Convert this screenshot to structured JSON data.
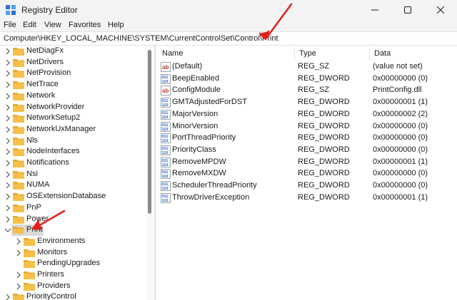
{
  "window": {
    "title": "Registry Editor"
  },
  "menu": {
    "file": "File",
    "edit": "Edit",
    "view": "View",
    "favorites": "Favorites",
    "help": "Help"
  },
  "address": "Computer\\HKEY_LOCAL_MACHINE\\SYSTEM\\CurrentControlSet\\Control\\Print",
  "tree": {
    "items": [
      "NetDiagFx",
      "NetDrivers",
      "NetProvision",
      "NetTrace",
      "Network",
      "NetworkProvider",
      "NetworkSetup2",
      "NetworkUxManager",
      "Nls",
      "NodeInterfaces",
      "Notifications",
      "Nsi",
      "NUMA",
      "OSExtensionDatabase",
      "PnP",
      "Power",
      "Print"
    ],
    "children": [
      "Environments",
      "Monitors",
      "PendingUpgrades",
      "Printers",
      "Providers"
    ],
    "last": "PriorityControl"
  },
  "columns": {
    "name": "Name",
    "type": "Type",
    "data": "Data"
  },
  "values": [
    {
      "icon": "string-value-icon",
      "name": "(Default)",
      "type": "REG_SZ",
      "data": "(value not set)"
    },
    {
      "icon": "binary-value-icon",
      "name": "BeepEnabled",
      "type": "REG_DWORD",
      "data": "0x00000000 (0)"
    },
    {
      "icon": "string-value-icon",
      "name": "ConfigModule",
      "type": "REG_SZ",
      "data": "PrintConfig.dll"
    },
    {
      "icon": "binary-value-icon",
      "name": "GMTAdjustedForDST",
      "type": "REG_DWORD",
      "data": "0x00000001 (1)"
    },
    {
      "icon": "binary-value-icon",
      "name": "MajorVersion",
      "type": "REG_DWORD",
      "data": "0x00000002 (2)"
    },
    {
      "icon": "binary-value-icon",
      "name": "MinorVersion",
      "type": "REG_DWORD",
      "data": "0x00000000 (0)"
    },
    {
      "icon": "binary-value-icon",
      "name": "PortThreadPriority",
      "type": "REG_DWORD",
      "data": "0x00000000 (0)"
    },
    {
      "icon": "binary-value-icon",
      "name": "PriorityClass",
      "type": "REG_DWORD",
      "data": "0x00000000 (0)"
    },
    {
      "icon": "binary-value-icon",
      "name": "RemoveMPDW",
      "type": "REG_DWORD",
      "data": "0x00000001 (1)"
    },
    {
      "icon": "binary-value-icon",
      "name": "RemoveMXDW",
      "type": "REG_DWORD",
      "data": "0x00000000 (0)"
    },
    {
      "icon": "binary-value-icon",
      "name": "SchedulerThreadPriority",
      "type": "REG_DWORD",
      "data": "0x00000000 (0)"
    },
    {
      "icon": "binary-value-icon",
      "name": "ThrowDriverException",
      "type": "REG_DWORD",
      "data": "0x00000001 (1)"
    }
  ],
  "colors": {
    "annotation_arrow": "#e0201c",
    "folder": "#f5c04a",
    "selection": "#d9d9d9"
  }
}
